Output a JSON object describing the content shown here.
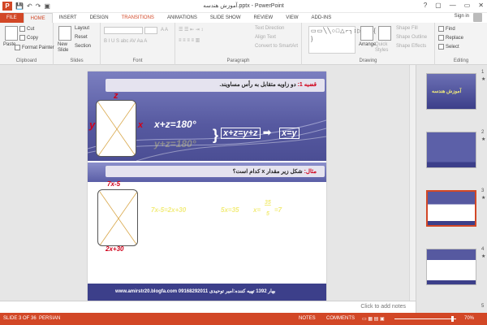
{
  "window": {
    "title": "آموزش هندسه.pptx - PowerPoint",
    "controls": [
      "?",
      "▢",
      "—",
      "▭",
      "✕"
    ]
  },
  "quick_access": {
    "app_icon": "P",
    "items": [
      "💾",
      "↶",
      "↷",
      "▣"
    ]
  },
  "tabs": [
    "FILE",
    "HOME",
    "INSERT",
    "DESIGN",
    "TRANSITIONS",
    "ANIMATIONS",
    "SLIDE SHOW",
    "REVIEW",
    "VIEW",
    "ADD-INS"
  ],
  "account": {
    "sign_in": "Sign in"
  },
  "ribbon": {
    "clipboard": {
      "label": "Clipboard",
      "paste": "Paste",
      "cut": "Cut",
      "copy": "Copy",
      "format_painter": "Format Painter"
    },
    "slides": {
      "label": "Slides",
      "new_slide": "New Slide",
      "layout": "Layout",
      "reset": "Reset",
      "section": "Section"
    },
    "font": {
      "label": "Font",
      "format_row": "B I U S abc AV Aa A"
    },
    "paragraph": {
      "label": "Paragraph",
      "text_direction": "Text Direction",
      "align_text": "Align Text",
      "convert_smartart": "Convert to SmartArt"
    },
    "drawing": {
      "label": "Drawing",
      "arrange": "Arrange",
      "quick_styles": "Quick Styles",
      "shape_fill": "Shape Fill",
      "shape_outline": "Shape Outline",
      "shape_effects": "Shape Effects",
      "shapes": "▭▭╲╲○□△⌐╮↕▷◁☆{ }"
    },
    "editing": {
      "label": "Editing",
      "find": "Find",
      "replace": "Replace",
      "select": "Select"
    }
  },
  "slide": {
    "title_prefix": "قضیه 1:",
    "title_text": "دو زاویه متقابل به رأس مساویند.",
    "example_prefix": "مثال:",
    "example_text": "شکل زیر مقدار x کدام است؟",
    "fig1_labels": {
      "top": "z",
      "left": "y",
      "right": "x"
    },
    "eq1": "x+z=180°",
    "eq1_faded": "y+z=180°",
    "eq2": "x+z=y+z",
    "eq2_result": "x=y",
    "fig2_top": "7x-5",
    "fig2_bottom": "2x+30",
    "solution": [
      "7x-5=2x+30",
      "5x=35",
      "x=",
      "35",
      "5",
      "=7"
    ],
    "footer": "www.amirstr20.blogfa.com  09168292011   بهار 1392   تهیه کننده:امیر توحیدی"
  },
  "thumbnails": [
    {
      "num": "1",
      "star": "★"
    },
    {
      "num": "2",
      "star": "★"
    },
    {
      "num": "3",
      "star": "★"
    },
    {
      "num": "4",
      "star": "★"
    },
    {
      "num": "5",
      "star": "★"
    }
  ],
  "thumb_text": {
    "slide1": "آموزش هندسه"
  },
  "notes": {
    "placeholder": "Click to add notes"
  },
  "status": {
    "slide": "SLIDE 3 OF 36",
    "language": "PERSIAN",
    "notes": "NOTES",
    "comments": "COMMENTS",
    "zoom": "70%"
  },
  "colors": {
    "accent": "#d24726",
    "slide_blue": "#5659a0",
    "equation_yellow": "#f2ec7a",
    "label_red": "#d0021b"
  }
}
